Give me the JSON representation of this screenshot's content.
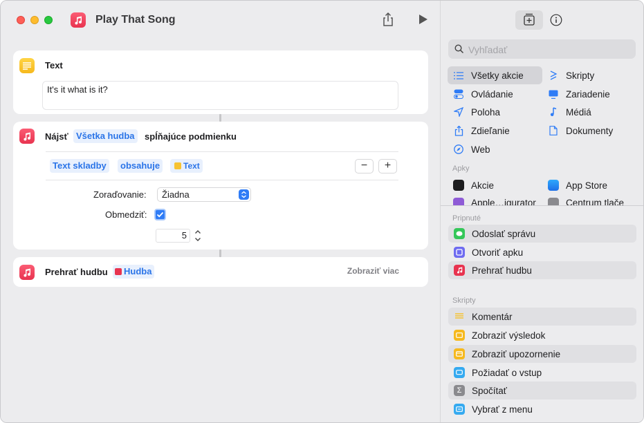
{
  "window": {
    "title": "Play That Song"
  },
  "actions": {
    "text": {
      "title": "Text",
      "content": "It's it what is it?"
    },
    "find": {
      "verb": "Nájsť",
      "source_token": "Všetka hudba",
      "suffix": "spĺňajúce podmienku",
      "filter": {
        "field": "Text skladby",
        "operator": "obsahuje",
        "value": "Text"
      },
      "sort_label": "Zoraďovanie:",
      "sort_value": "Žiadna",
      "limit_label": "Obmedziť:",
      "limit_checked": true,
      "limit_value": "5"
    },
    "play": {
      "title": "Prehrať hudbu",
      "token": "Hudba",
      "show_more": "Zobraziť viac"
    }
  },
  "library": {
    "search_placeholder": "Vyhľadať",
    "categories": [
      {
        "label": "Všetky akcie",
        "icon": "list-icon"
      },
      {
        "label": "Skripty",
        "icon": "scroll-icon"
      },
      {
        "label": "Ovládanie",
        "icon": "toggle-icon"
      },
      {
        "label": "Zariadenie",
        "icon": "monitor-icon"
      },
      {
        "label": "Poloha",
        "icon": "location-arrow-icon"
      },
      {
        "label": "Médiá",
        "icon": "music-note-icon"
      },
      {
        "label": "Zdieľanie",
        "icon": "share-icon"
      },
      {
        "label": "Dokumenty",
        "icon": "document-icon"
      },
      {
        "label": "Web",
        "icon": "compass-icon"
      }
    ],
    "apps_header": "Apky",
    "apps": [
      {
        "label": "Akcie",
        "icon": "stocks-icon"
      },
      {
        "label": "App Store",
        "icon": "app-store-icon"
      },
      {
        "label": "Apple…igurator",
        "icon": "configurator-icon"
      },
      {
        "label": "Centrum tlače",
        "icon": "printer-icon"
      }
    ],
    "pinned_header": "Pripnuté",
    "pinned": [
      {
        "label": "Odoslať správu",
        "icon": "messages-icon"
      },
      {
        "label": "Otvoriť apku",
        "icon": "open-app-icon"
      },
      {
        "label": "Prehrať hudbu",
        "icon": "music-icon"
      }
    ],
    "scripts_header": "Skripty",
    "scripts": [
      {
        "label": "Komentár",
        "icon": "comment-icon"
      },
      {
        "label": "Zobraziť výsledok",
        "icon": "show-result-icon"
      },
      {
        "label": "Zobraziť upozornenie",
        "icon": "alert-icon"
      },
      {
        "label": "Požiadať o vstup",
        "icon": "ask-input-icon"
      },
      {
        "label": "Spočítať",
        "icon": "sum-icon"
      },
      {
        "label": "Vybrať z menu",
        "icon": "menu-icon"
      }
    ]
  },
  "colors": {
    "accent": "#2f7cf6",
    "token_text": "#2a74e8",
    "music_red": "#e8334f",
    "text_yellow": "#f6b91d"
  }
}
